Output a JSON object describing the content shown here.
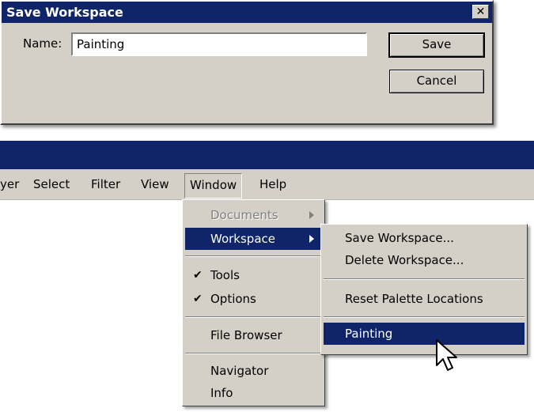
{
  "dialog": {
    "title": "Save Workspace",
    "close_glyph": "✕",
    "name_label": "Name:",
    "name_value": "Painting",
    "save_label": "Save",
    "cancel_label": "Cancel"
  },
  "menubar": {
    "items": [
      "yer",
      "Select",
      "Filter",
      "View",
      "Window",
      "Help"
    ]
  },
  "window_menu": {
    "items": [
      {
        "label": "Documents",
        "state": "disabled",
        "submenu": true
      },
      {
        "label": "Workspace",
        "state": "active",
        "submenu": true
      },
      {
        "label": "Tools",
        "checked": true
      },
      {
        "label": "Options",
        "checked": true
      },
      {
        "label": "File Browser"
      },
      {
        "label": "Navigator"
      },
      {
        "label": "Info"
      }
    ],
    "check_glyph": "✔"
  },
  "workspace_submenu": {
    "items": [
      {
        "label": "Save Workspace..."
      },
      {
        "label": "Delete Workspace..."
      },
      {
        "label": "Reset Palette Locations"
      },
      {
        "label": "Painting",
        "state": "active"
      }
    ]
  },
  "colors": {
    "title_bar": "#10246a",
    "highlight": "#10246a",
    "face": "#d4d0c8"
  },
  "icons": [
    "close-icon",
    "submenu-arrow-icon",
    "check-icon",
    "mouse-pointer-icon"
  ]
}
